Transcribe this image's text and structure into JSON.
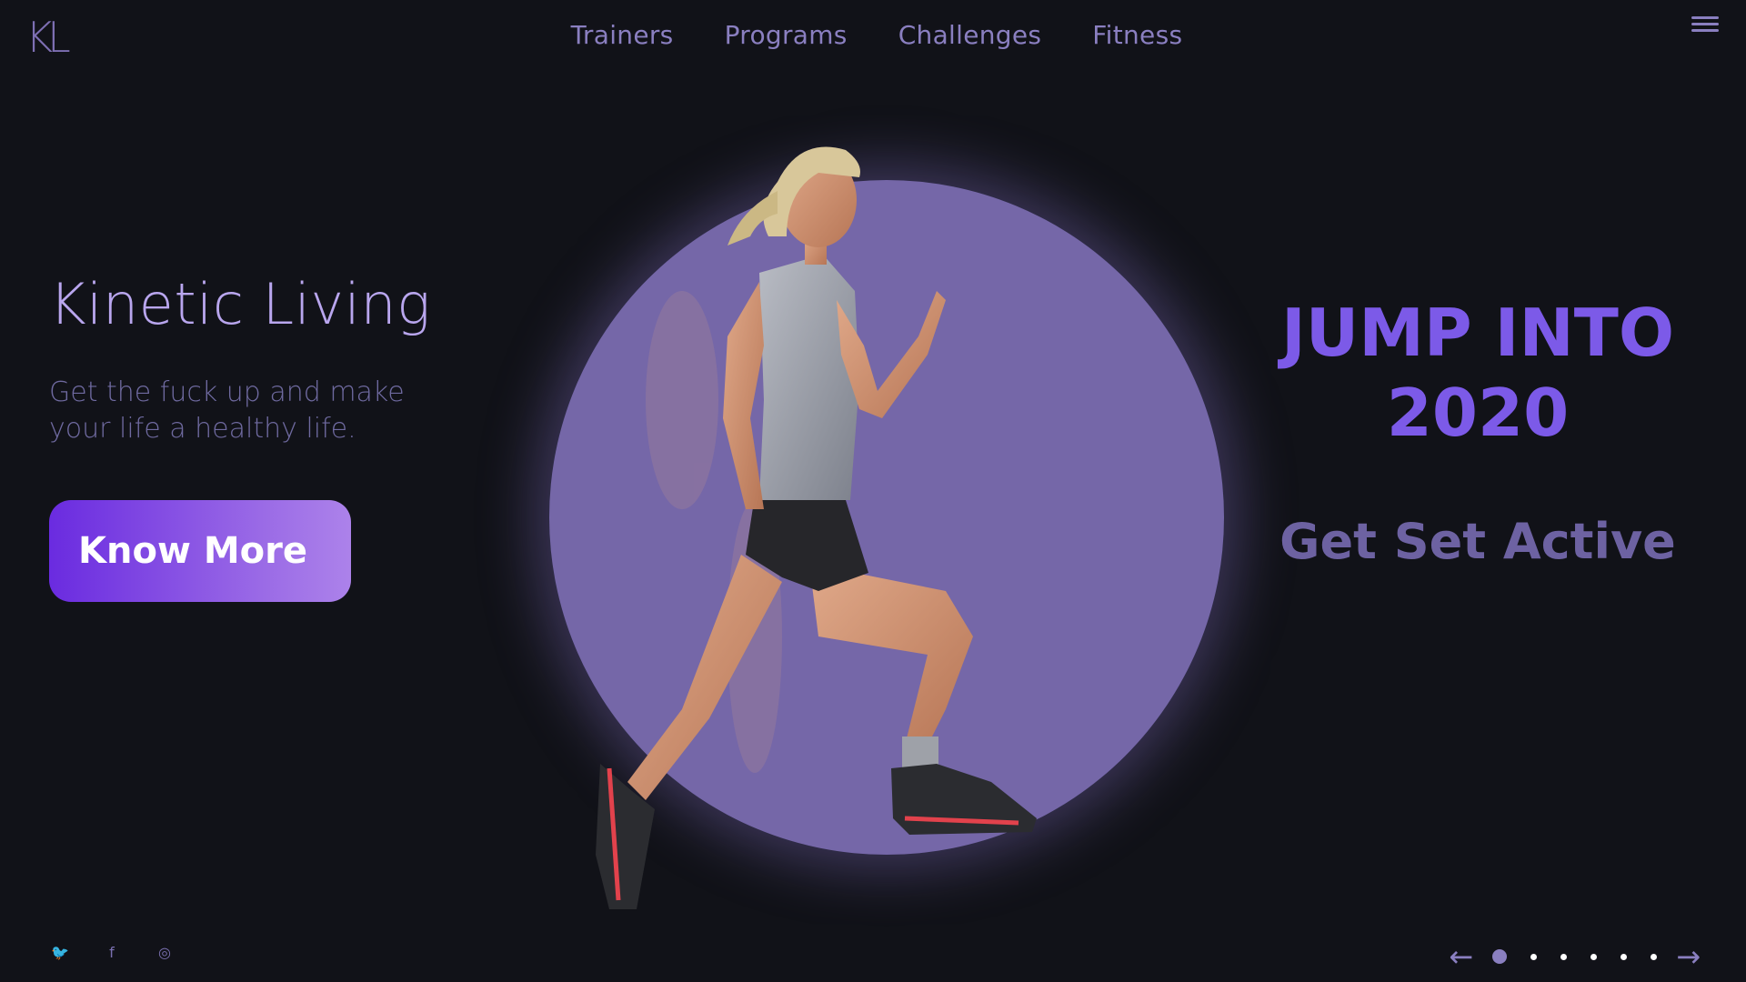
{
  "logo": {
    "text": "KL"
  },
  "nav": {
    "items": [
      "Trainers",
      "Programs",
      "Challenges",
      "Fitness"
    ]
  },
  "hero": {
    "title": "Kinetic Living",
    "subtitle": "Get the fuck up and make your life a healthy life.",
    "cta_label": "Know More"
  },
  "promo": {
    "line1": "JUMP INTO",
    "line2": "2020",
    "tagline": "Get Set Active"
  },
  "social": {
    "icons": [
      "twitter-icon",
      "facebook-icon",
      "instagram-icon"
    ]
  },
  "slider": {
    "total": 6,
    "active_index": 0
  },
  "colors": {
    "background": "#111218",
    "accent": "#7c5ae8",
    "circle": "#7567a8",
    "nav": "#8a7fc0"
  }
}
